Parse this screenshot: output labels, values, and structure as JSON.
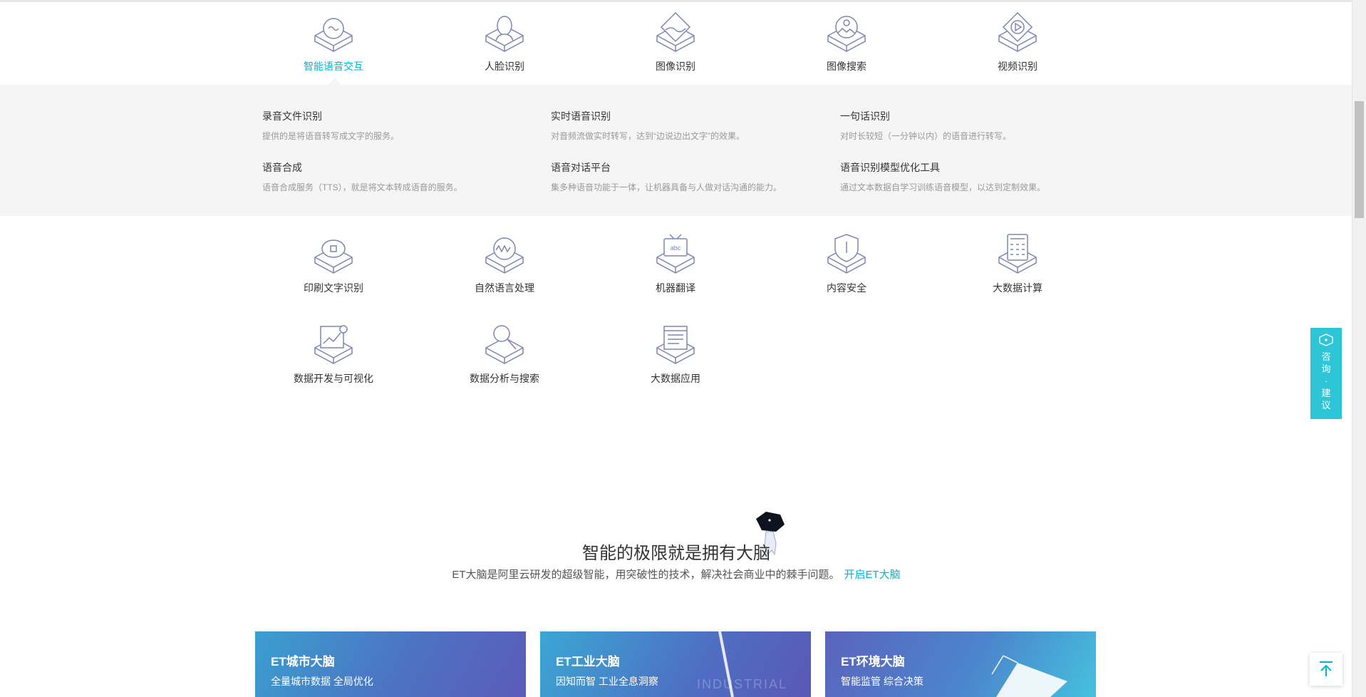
{
  "categories_row1": [
    {
      "label": "智能语音交互",
      "icon": "voice-icon"
    },
    {
      "label": "人脸识别",
      "icon": "face-icon"
    },
    {
      "label": "图像识别",
      "icon": "image-icon"
    },
    {
      "label": "图像搜索",
      "icon": "image-search-icon"
    },
    {
      "label": "视频识别",
      "icon": "video-icon"
    }
  ],
  "active_category": "智能语音交互",
  "voice_panel": [
    {
      "title": "录音文件识别",
      "desc": "提供的是将语音转写成文字的服务。"
    },
    {
      "title": "实时语音识别",
      "desc": "对音频流做实时转写，达到“边说边出文字”的效果。"
    },
    {
      "title": "一句话识别",
      "desc": "对时长较短（一分钟以内）的语音进行转写。"
    },
    {
      "title": "语音合成",
      "desc": "语音合成服务（TTS），就是将文本转成语音的服务。"
    },
    {
      "title": "语音对话平台",
      "desc": "集多种语音功能于一体，让机器具备与人做对话沟通的能力。"
    },
    {
      "title": "语音识别模型优化工具",
      "desc": "通过文本数据自学习训练语音模型，以达到定制效果。"
    }
  ],
  "categories_row2": [
    {
      "label": "印刷文字识别",
      "icon": "ocr-icon"
    },
    {
      "label": "自然语言处理",
      "icon": "nlp-icon"
    },
    {
      "label": "机器翻译",
      "icon": "translate-icon"
    },
    {
      "label": "内容安全",
      "icon": "security-shield-icon"
    },
    {
      "label": "大数据计算",
      "icon": "calculator-icon"
    }
  ],
  "categories_row3": [
    {
      "label": "数据开发与可视化",
      "icon": "data-visual-icon"
    },
    {
      "label": "数据分析与搜索",
      "icon": "data-search-icon"
    },
    {
      "label": "大数据应用",
      "icon": "big-data-app-icon"
    }
  ],
  "et_section": {
    "title": "智能的极限就是拥有大脑",
    "subtitle": "ET大脑是阿里云研发的超级智能，用突破性的技术，解决社会商业中的棘手问题。",
    "link": "开启ET大脑"
  },
  "et_cards": [
    {
      "title": "ET城市大脑",
      "subtitle": "全量城市数据 全局优化"
    },
    {
      "title": "ET工业大脑",
      "subtitle": "因知而智 工业全息洞察",
      "ghost": "INDUSTRIAL"
    },
    {
      "title": "ET环境大脑",
      "subtitle": "智能监管 综合决策"
    }
  ],
  "consult_button": "咨询·建议",
  "colors": {
    "accent": "#00b7d3",
    "panel_bg": "#f5f5f5",
    "icon_stroke": "#7d86b4",
    "consult_bg": "#2ec6d6"
  }
}
